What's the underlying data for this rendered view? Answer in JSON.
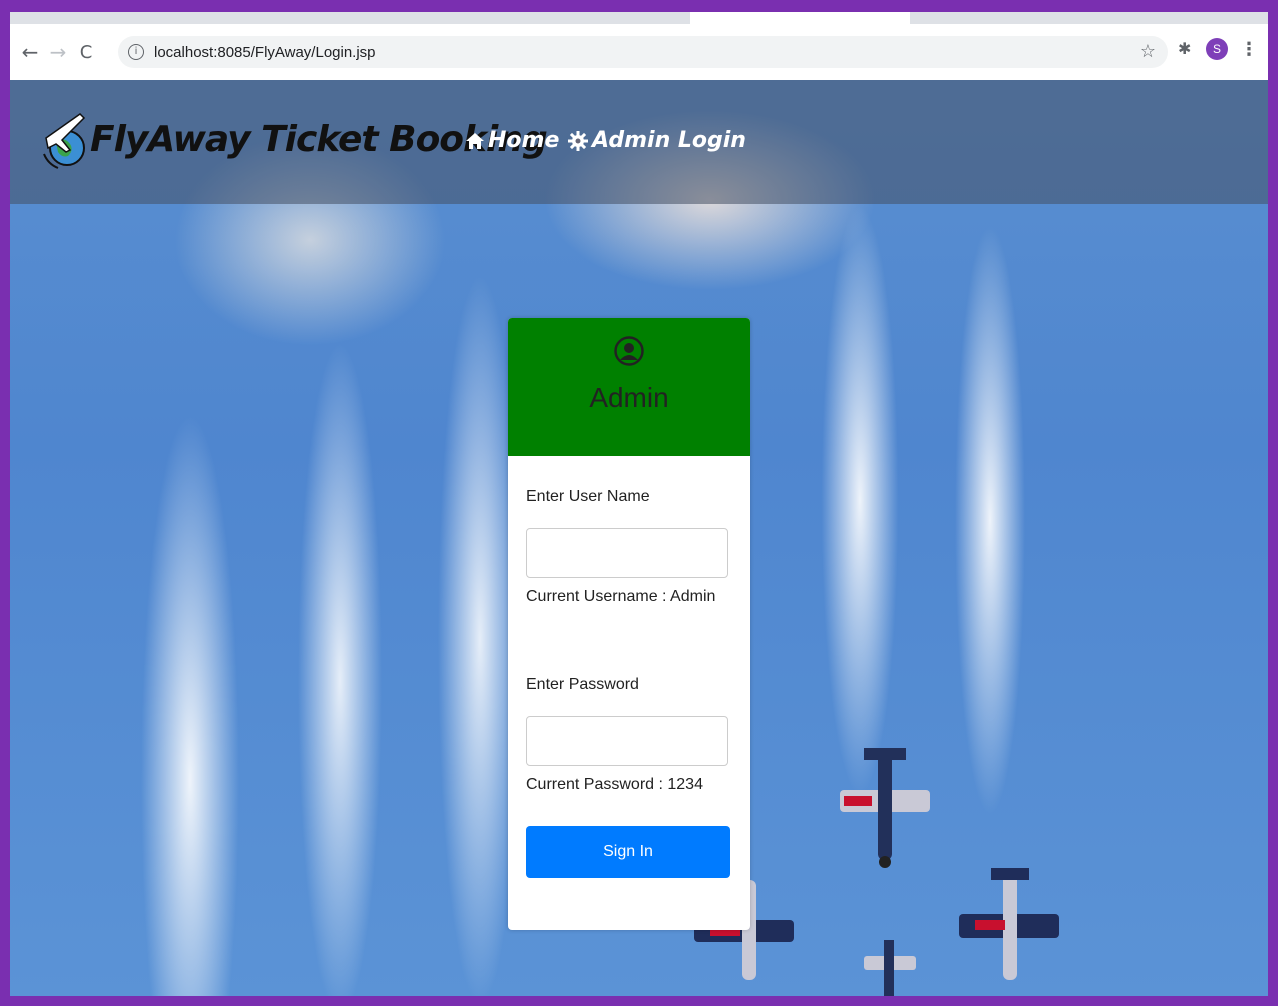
{
  "browser": {
    "url": "localhost:8085/FlyAway/Login.jsp",
    "profile_initial": "S",
    "back_glyph": "←",
    "forward_glyph": "→",
    "reload_glyph": "C",
    "info_glyph": "i",
    "star_glyph": "☆",
    "extensions_glyph": "✱",
    "menu_glyph": "⋮"
  },
  "navbar": {
    "brand": "FlyAway Ticket Booking",
    "links": [
      {
        "label": "Home",
        "icon": "home-icon"
      },
      {
        "label": "Admin Login",
        "icon": "gear-icon"
      }
    ]
  },
  "login_card": {
    "title": "Admin",
    "icon": "user-circle-icon",
    "header_color": "#008000",
    "username_label": "Enter User Name",
    "username_value": "",
    "username_hint": "Current Username : Admin",
    "password_label": "Enter Password",
    "password_value": "",
    "password_hint": "Current Password : 1234",
    "submit_label": "Sign In",
    "button_color": "#007bff"
  }
}
